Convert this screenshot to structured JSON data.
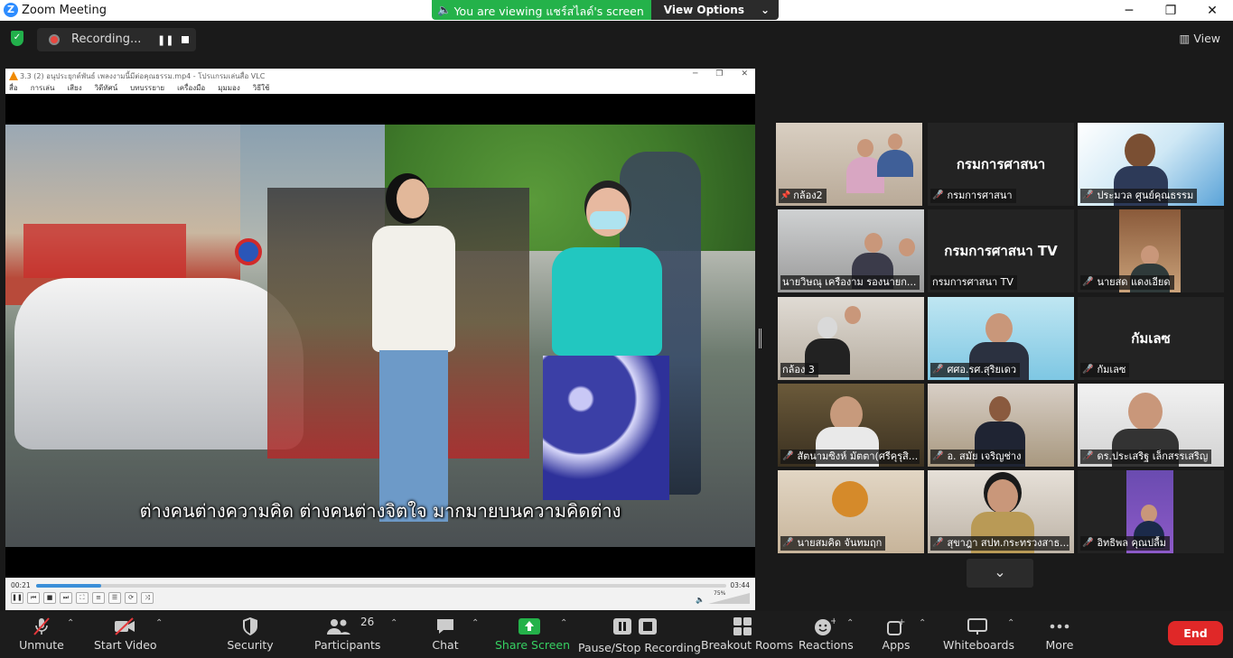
{
  "window": {
    "title": "Zoom Meeting"
  },
  "share_banner": {
    "viewing_text": "You are viewing แชร์สไลด์'s screen",
    "view_options": "View Options"
  },
  "recording": {
    "label": "Recording..."
  },
  "view_label": "View",
  "vlc": {
    "title": "3.3 (2) อนุประยุกต์พันธ์ เพลงงามนี้มีต่อคุณธรรม.mp4 - โปรแกรมเล่นสื่อ VLC",
    "menu": [
      "สื่อ",
      "การเล่น",
      "เสียง",
      "วิดีทัศน์",
      "บทบรรยาย",
      "เครื่องมือ",
      "มุมมอง",
      "วิธีใช้"
    ],
    "subtitle": "ต่างคนต่างความคิด ต่างคนต่างจิตใจ มากมายบนความคิดต่าง",
    "time_current": "00:21",
    "time_total": "03:44",
    "progress": 0.094,
    "volume": "75%"
  },
  "participants_tiles": [
    {
      "name": "กล้อง2",
      "big_label": "",
      "muted": false,
      "active": true
    },
    {
      "name": "กรมการศาสนา",
      "big_label": "กรมการศาสนา",
      "muted": true
    },
    {
      "name": "ประมวล ศูนย์คุณธรรม",
      "big_label": "",
      "muted": true
    },
    {
      "name": "นายวิษณุ เครืองาม รองนายก...",
      "big_label": "",
      "muted": false
    },
    {
      "name": "กรมการศาสนา TV",
      "big_label": "กรมการศาสนา TV",
      "muted": false
    },
    {
      "name": "นายสด แดงเอียด",
      "big_label": "",
      "muted": true
    },
    {
      "name": "กล้อง 3",
      "big_label": "",
      "muted": false
    },
    {
      "name": "ศศอ.รศ.สุริยเดว",
      "big_label": "",
      "muted": true
    },
    {
      "name": "กัมเลซ",
      "big_label": "กัมเลซ",
      "muted": true
    },
    {
      "name": "สัตนามซิงห์ มัตตา(ศรีคุรุสิ...",
      "big_label": "",
      "muted": true
    },
    {
      "name": "อ. สมัย เจริญช่าง",
      "big_label": "",
      "muted": true
    },
    {
      "name": "ดร.ประเสริฐ เล็กสรรเสริญ",
      "big_label": "",
      "muted": true
    },
    {
      "name": "นายสมคิด จันทมฤก",
      "big_label": "",
      "muted": true
    },
    {
      "name": "สุขาฎา สปท.กระทรวงสาธ...",
      "big_label": "",
      "muted": true
    },
    {
      "name": "อิทธิพล คุณปลื้ม",
      "big_label": "",
      "muted": true
    }
  ],
  "toolbar": {
    "unmute": "Unmute",
    "start_video": "Start Video",
    "security": "Security",
    "participants": "Participants",
    "participants_count": "26",
    "chat": "Chat",
    "share_screen": "Share Screen",
    "pause_stop_recording": "Pause/Stop Recording",
    "breakout_rooms": "Breakout Rooms",
    "reactions": "Reactions",
    "apps": "Apps",
    "whiteboards": "Whiteboards",
    "more": "More",
    "end": "End"
  },
  "colors": {
    "share_green": "#24b24a",
    "end_red": "#e02828",
    "active_speaker": "#e6e84a"
  }
}
